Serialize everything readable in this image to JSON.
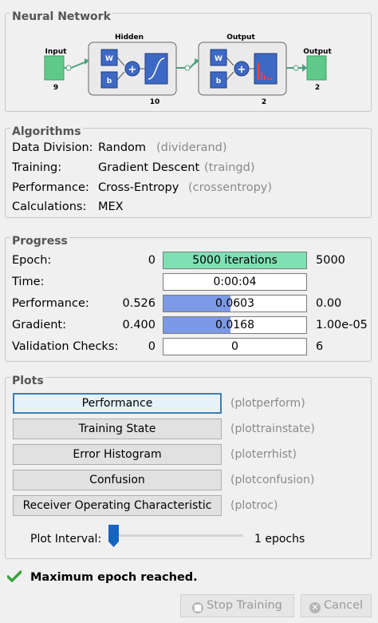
{
  "sections": {
    "network": "Neural Network",
    "algorithms": "Algorithms",
    "progress": "Progress",
    "plots": "Plots"
  },
  "network": {
    "input_label": "Input",
    "input_size": "9",
    "hidden_label": "Hidden",
    "hidden_size": "10",
    "output_layer_label": "Output",
    "output_layer_size": "2",
    "output_label": "Output",
    "output_size": "2",
    "weight_symbol": "W",
    "bias_symbol": "b",
    "sum_symbol": "+"
  },
  "algorithms": [
    {
      "label": "Data Division:",
      "value": "Random",
      "fn": "(dividerand)"
    },
    {
      "label": "Training:",
      "value": "Gradient Descent",
      "fn": "(traingd)"
    },
    {
      "label": "Performance:",
      "value": "Cross-Entropy",
      "fn": "(crossentropy)"
    },
    {
      "label": "Calculations:",
      "value": "MEX",
      "fn": ""
    }
  ],
  "progress": {
    "epoch": {
      "label": "Epoch:",
      "start": "0",
      "current": "5000 iterations",
      "end": "5000",
      "fraction": 1.0,
      "color": "#7fe0b4"
    },
    "time": {
      "label": "Time:",
      "start": "",
      "current": "0:00:04",
      "end": "",
      "fraction": 0.0
    },
    "performance": {
      "label": "Performance:",
      "start": "0.526",
      "current": "0.0603",
      "end": "0.00",
      "fraction": 0.47,
      "color": "#7c99e6"
    },
    "gradient": {
      "label": "Gradient:",
      "start": "0.400",
      "current": "0.0168",
      "end": "1.00e-05",
      "fraction": 0.47,
      "color": "#7c99e6"
    },
    "validation": {
      "label": "Validation Checks:",
      "start": "0",
      "current": "0",
      "end": "6",
      "fraction": 0.0
    }
  },
  "plots": {
    "buttons": [
      {
        "label": "Performance",
        "fn": "(plotperform)"
      },
      {
        "label": "Training State",
        "fn": "(plottrainstate)"
      },
      {
        "label": "Error Histogram",
        "fn": "(ploterrhist)"
      },
      {
        "label": "Confusion",
        "fn": "(plotconfusion)"
      },
      {
        "label": "Receiver Operating Characteristic",
        "fn": "(plotroc)"
      }
    ],
    "interval_label": "Plot Interval:",
    "interval_value": "1 epochs",
    "interval_fraction": 0.0
  },
  "status": {
    "message": "Maximum epoch reached.",
    "icon": "checkmark-icon",
    "color": "#3aa33a"
  },
  "buttons": {
    "stop": "Stop Training",
    "cancel": "Cancel"
  }
}
